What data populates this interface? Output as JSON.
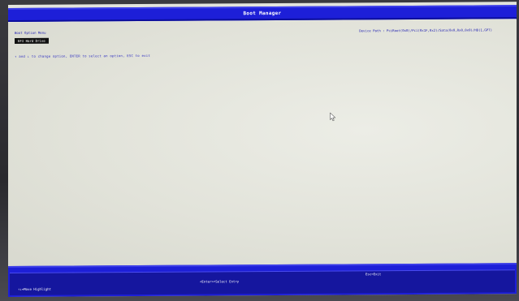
{
  "window": {
    "title": "Boot Manager"
  },
  "main": {
    "section_label": "Boot Option Menu",
    "selected_item": "EFI Hard Drive",
    "help_text": "↑ and ↓ to change option, ENTER to select an option, ESC to exit",
    "boot_order": "Device Path : PciRoot(0x0)/Pci(0x1F,0x2)/Sata(0x0,0x0,0x0)/HD(1,GPT)"
  },
  "footer": {
    "move_hint": "↑↓=Move Highlight",
    "enter_hint": "<Enter>=Select Entry",
    "esc_hint": "Esc=Exit"
  },
  "colors": {
    "title_bar": "#1d1fd8",
    "screen_bg": "#e3e4dc",
    "text_blue": "#1a1ab0",
    "highlight_bg": "#111111"
  },
  "icons": {
    "pointer": "mouse-pointer-icon"
  }
}
